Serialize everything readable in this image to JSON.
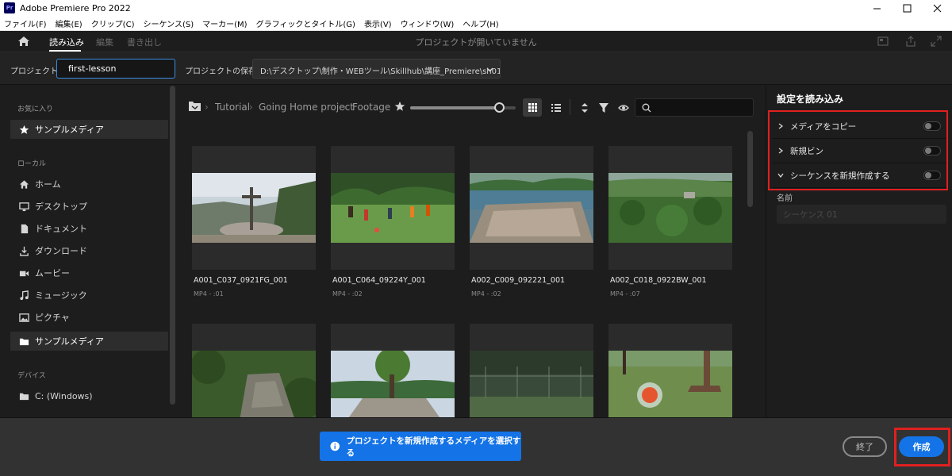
{
  "window": {
    "title": "Adobe Premiere Pro 2022",
    "app_icon_text": "Pr"
  },
  "menu": [
    "ファイル(F)",
    "編集(E)",
    "クリップ(C)",
    "シーケンス(S)",
    "マーカー(M)",
    "グラフィックとタイトル(G)",
    "表示(V)",
    "ウィンドウ(W)",
    "ヘルプ(H)"
  ],
  "header": {
    "tabs": [
      {
        "label": "読み込み",
        "active": true
      },
      {
        "label": "編集",
        "active": false
      },
      {
        "label": "書き出し",
        "active": false
      }
    ],
    "status": "プロジェクトが開いていません"
  },
  "project": {
    "name_label": "プロジェクト名",
    "name_value": "first-lesson",
    "location_label": "プロジェクトの保存先",
    "location_value": "D:\\デスクトップ\\制作・WEBツール\\Skillhub\\講座_Premiere\\sh01..."
  },
  "sidebar": {
    "favorites_header": "お気に入り",
    "favorites": [
      {
        "label": "サンプルメディア",
        "icon": "star-icon",
        "selected": true
      }
    ],
    "local_header": "ローカル",
    "local": [
      {
        "label": "ホーム",
        "icon": "home-icon"
      },
      {
        "label": "デスクトップ",
        "icon": "desktop-icon"
      },
      {
        "label": "ドキュメント",
        "icon": "document-icon"
      },
      {
        "label": "ダウンロード",
        "icon": "download-icon"
      },
      {
        "label": "ムービー",
        "icon": "movie-icon"
      },
      {
        "label": "ミュージック",
        "icon": "music-icon"
      },
      {
        "label": "ピクチャ",
        "icon": "picture-icon"
      },
      {
        "label": "サンプルメディア",
        "icon": "folder-icon",
        "selected": true
      }
    ],
    "devices_header": "デバイス",
    "devices": [
      {
        "label": "C: (Windows)",
        "icon": "folder-icon"
      }
    ]
  },
  "browser": {
    "breadcrumb": [
      "Tutorial",
      "Going Home project",
      "Footage"
    ],
    "thumbnail_size_level": 0.85,
    "search_placeholder": "",
    "clips": [
      {
        "name": "A001_C037_0921FG_001",
        "meta": "MP4 - :01",
        "scene": "cross"
      },
      {
        "name": "A001_C064_09224Y_001",
        "meta": "MP4 - :02",
        "scene": "soccer"
      },
      {
        "name": "A002_C009_092221_001",
        "meta": "MP4 - :02",
        "scene": "town"
      },
      {
        "name": "A002_C018_0922BW_001",
        "meta": "MP4 - :07",
        "scene": "forest"
      },
      {
        "name": "",
        "meta": "",
        "scene": "ruins"
      },
      {
        "name": "",
        "meta": "",
        "scene": "tree"
      },
      {
        "name": "",
        "meta": "",
        "scene": "fence"
      },
      {
        "name": "",
        "meta": "",
        "scene": "ball"
      }
    ]
  },
  "settings": {
    "title": "設定を読み込み",
    "options": [
      {
        "label": "メディアをコピー",
        "expanded": false,
        "enabled": false
      },
      {
        "label": "新規ビン",
        "expanded": false,
        "enabled": false
      },
      {
        "label": "シーケンスを新規作成する",
        "expanded": true,
        "enabled": false
      }
    ],
    "name_label": "名前",
    "name_placeholder": "シーケンス 01"
  },
  "footer": {
    "notice": "プロジェクトを新規作成するメディアを選択する",
    "exit_label": "終了",
    "create_label": "作成"
  },
  "colors": {
    "accent": "#1473e6",
    "highlight_box": "#e02020"
  }
}
